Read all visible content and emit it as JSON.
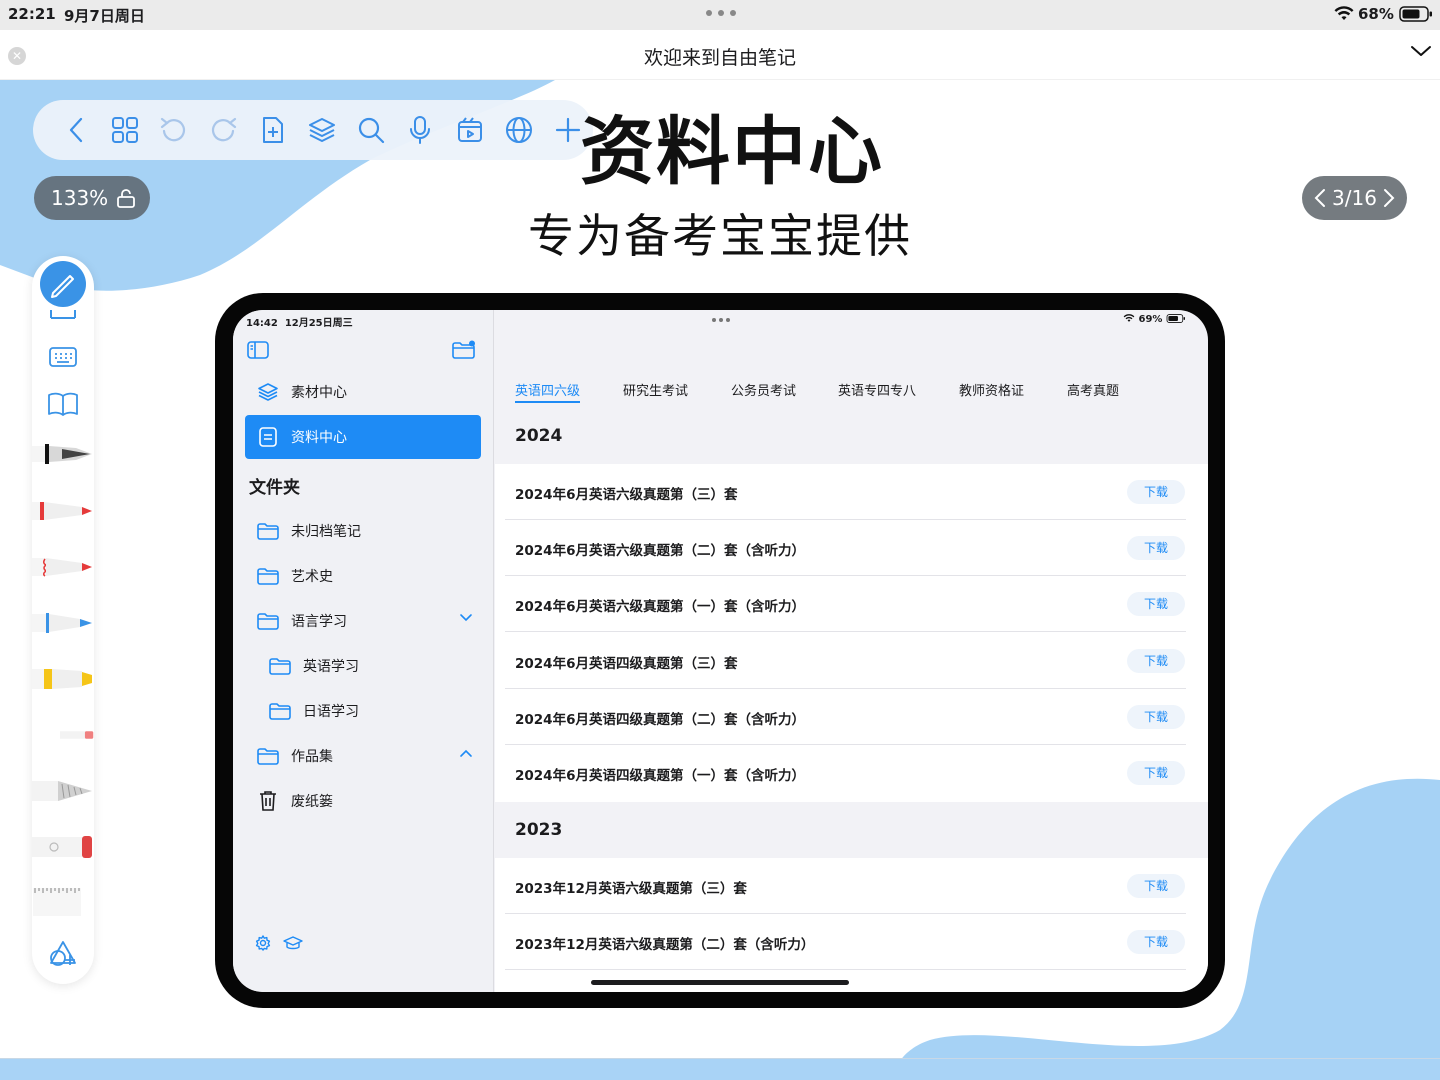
{
  "status_bar": {
    "time": "22:21",
    "date": "9月7日周日",
    "battery_percent": "68%"
  },
  "banner": {
    "title": "欢迎来到自由笔记"
  },
  "toolbar": {
    "items": [
      "back-icon",
      "grid-icon",
      "undo-icon",
      "redo-icon",
      "add-page-icon",
      "layers-icon",
      "search-icon",
      "microphone-icon",
      "media-icon",
      "globe-icon",
      "plus-icon"
    ]
  },
  "zoom": {
    "label": "133%"
  },
  "pager": {
    "label": "3/16"
  },
  "slide": {
    "heading": "资料中心",
    "subheading": "专为备考宝宝提供"
  },
  "tool_rail": {
    "items": [
      "pencil-icon",
      "keyboard-icon",
      "book-icon",
      "fountain-pen-icon",
      "red-pen-icon",
      "red-brush-icon",
      "blue-pen-icon",
      "yellow-highlighter-icon",
      "eraser-icon",
      "pencil-tip-icon",
      "lasso-eraser-icon",
      "ruler-icon",
      "shapes-icon"
    ]
  },
  "device_screen": {
    "status": {
      "time": "14:42",
      "date": "12月25日周三",
      "battery": "69%"
    },
    "sidebar": {
      "top_items": [
        {
          "label": "素材中心",
          "icon": "stack-icon"
        },
        {
          "label": "资料中心",
          "icon": "document-icon",
          "active": true
        }
      ],
      "folders_heading": "文件夹",
      "folders": [
        {
          "label": "未归档笔记",
          "icon": "folder-icon"
        },
        {
          "label": "艺术史",
          "icon": "folder-icon"
        },
        {
          "label": "语言学习",
          "icon": "folder-icon",
          "chevron": "down"
        },
        {
          "label": "英语学习",
          "icon": "folder-icon",
          "indent": true
        },
        {
          "label": "日语学习",
          "icon": "folder-icon",
          "indent": true
        },
        {
          "label": "作品集",
          "icon": "folder-icon",
          "chevron": "up"
        },
        {
          "label": "废纸篓",
          "icon": "trash-icon"
        }
      ]
    },
    "tabs": [
      "英语四六级",
      "研究生考试",
      "公务员考试",
      "英语专四专八",
      "教师资格证",
      "高考真题"
    ],
    "active_tab": "英语四六级",
    "download_label": "下载",
    "sections": [
      {
        "year": "2024",
        "rows": [
          "2024年6月英语六级真题第（三）套",
          "2024年6月英语六级真题第（二）套（含听力）",
          "2024年6月英语六级真题第（一）套（含听力）",
          "2024年6月英语四级真题第（三）套",
          "2024年6月英语四级真题第（二）套（含听力）",
          "2024年6月英语四级真题第（一）套（含听力）"
        ]
      },
      {
        "year": "2023",
        "rows": [
          "2023年12月英语六级真题第（三）套",
          "2023年12月英语六级真题第（二）套（含听力）"
        ]
      }
    ]
  }
}
